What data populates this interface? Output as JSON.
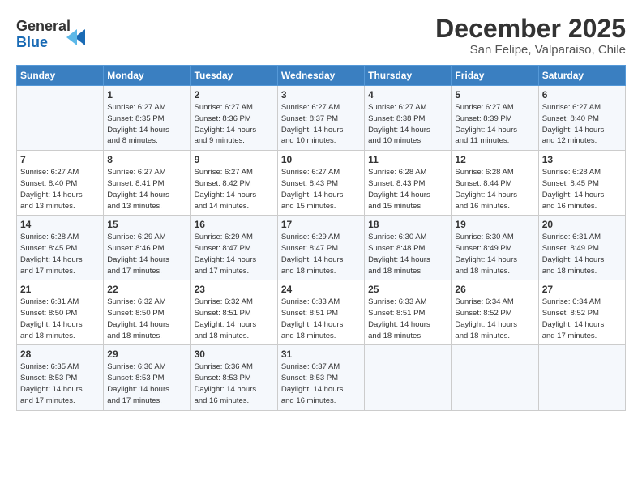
{
  "logo": {
    "line1": "General",
    "line2": "Blue"
  },
  "header": {
    "month": "December 2025",
    "location": "San Felipe, Valparaiso, Chile"
  },
  "weekdays": [
    "Sunday",
    "Monday",
    "Tuesday",
    "Wednesday",
    "Thursday",
    "Friday",
    "Saturday"
  ],
  "weeks": [
    [
      {
        "day": "",
        "info": ""
      },
      {
        "day": "1",
        "info": "Sunrise: 6:27 AM\nSunset: 8:35 PM\nDaylight: 14 hours\nand 8 minutes."
      },
      {
        "day": "2",
        "info": "Sunrise: 6:27 AM\nSunset: 8:36 PM\nDaylight: 14 hours\nand 9 minutes."
      },
      {
        "day": "3",
        "info": "Sunrise: 6:27 AM\nSunset: 8:37 PM\nDaylight: 14 hours\nand 10 minutes."
      },
      {
        "day": "4",
        "info": "Sunrise: 6:27 AM\nSunset: 8:38 PM\nDaylight: 14 hours\nand 10 minutes."
      },
      {
        "day": "5",
        "info": "Sunrise: 6:27 AM\nSunset: 8:39 PM\nDaylight: 14 hours\nand 11 minutes."
      },
      {
        "day": "6",
        "info": "Sunrise: 6:27 AM\nSunset: 8:40 PM\nDaylight: 14 hours\nand 12 minutes."
      }
    ],
    [
      {
        "day": "7",
        "info": "Sunrise: 6:27 AM\nSunset: 8:40 PM\nDaylight: 14 hours\nand 13 minutes."
      },
      {
        "day": "8",
        "info": "Sunrise: 6:27 AM\nSunset: 8:41 PM\nDaylight: 14 hours\nand 13 minutes."
      },
      {
        "day": "9",
        "info": "Sunrise: 6:27 AM\nSunset: 8:42 PM\nDaylight: 14 hours\nand 14 minutes."
      },
      {
        "day": "10",
        "info": "Sunrise: 6:27 AM\nSunset: 8:43 PM\nDaylight: 14 hours\nand 15 minutes."
      },
      {
        "day": "11",
        "info": "Sunrise: 6:28 AM\nSunset: 8:43 PM\nDaylight: 14 hours\nand 15 minutes."
      },
      {
        "day": "12",
        "info": "Sunrise: 6:28 AM\nSunset: 8:44 PM\nDaylight: 14 hours\nand 16 minutes."
      },
      {
        "day": "13",
        "info": "Sunrise: 6:28 AM\nSunset: 8:45 PM\nDaylight: 14 hours\nand 16 minutes."
      }
    ],
    [
      {
        "day": "14",
        "info": "Sunrise: 6:28 AM\nSunset: 8:45 PM\nDaylight: 14 hours\nand 17 minutes."
      },
      {
        "day": "15",
        "info": "Sunrise: 6:29 AM\nSunset: 8:46 PM\nDaylight: 14 hours\nand 17 minutes."
      },
      {
        "day": "16",
        "info": "Sunrise: 6:29 AM\nSunset: 8:47 PM\nDaylight: 14 hours\nand 17 minutes."
      },
      {
        "day": "17",
        "info": "Sunrise: 6:29 AM\nSunset: 8:47 PM\nDaylight: 14 hours\nand 18 minutes."
      },
      {
        "day": "18",
        "info": "Sunrise: 6:30 AM\nSunset: 8:48 PM\nDaylight: 14 hours\nand 18 minutes."
      },
      {
        "day": "19",
        "info": "Sunrise: 6:30 AM\nSunset: 8:49 PM\nDaylight: 14 hours\nand 18 minutes."
      },
      {
        "day": "20",
        "info": "Sunrise: 6:31 AM\nSunset: 8:49 PM\nDaylight: 14 hours\nand 18 minutes."
      }
    ],
    [
      {
        "day": "21",
        "info": "Sunrise: 6:31 AM\nSunset: 8:50 PM\nDaylight: 14 hours\nand 18 minutes."
      },
      {
        "day": "22",
        "info": "Sunrise: 6:32 AM\nSunset: 8:50 PM\nDaylight: 14 hours\nand 18 minutes."
      },
      {
        "day": "23",
        "info": "Sunrise: 6:32 AM\nSunset: 8:51 PM\nDaylight: 14 hours\nand 18 minutes."
      },
      {
        "day": "24",
        "info": "Sunrise: 6:33 AM\nSunset: 8:51 PM\nDaylight: 14 hours\nand 18 minutes."
      },
      {
        "day": "25",
        "info": "Sunrise: 6:33 AM\nSunset: 8:51 PM\nDaylight: 14 hours\nand 18 minutes."
      },
      {
        "day": "26",
        "info": "Sunrise: 6:34 AM\nSunset: 8:52 PM\nDaylight: 14 hours\nand 18 minutes."
      },
      {
        "day": "27",
        "info": "Sunrise: 6:34 AM\nSunset: 8:52 PM\nDaylight: 14 hours\nand 17 minutes."
      }
    ],
    [
      {
        "day": "28",
        "info": "Sunrise: 6:35 AM\nSunset: 8:53 PM\nDaylight: 14 hours\nand 17 minutes."
      },
      {
        "day": "29",
        "info": "Sunrise: 6:36 AM\nSunset: 8:53 PM\nDaylight: 14 hours\nand 17 minutes."
      },
      {
        "day": "30",
        "info": "Sunrise: 6:36 AM\nSunset: 8:53 PM\nDaylight: 14 hours\nand 16 minutes."
      },
      {
        "day": "31",
        "info": "Sunrise: 6:37 AM\nSunset: 8:53 PM\nDaylight: 14 hours\nand 16 minutes."
      },
      {
        "day": "",
        "info": ""
      },
      {
        "day": "",
        "info": ""
      },
      {
        "day": "",
        "info": ""
      }
    ]
  ]
}
